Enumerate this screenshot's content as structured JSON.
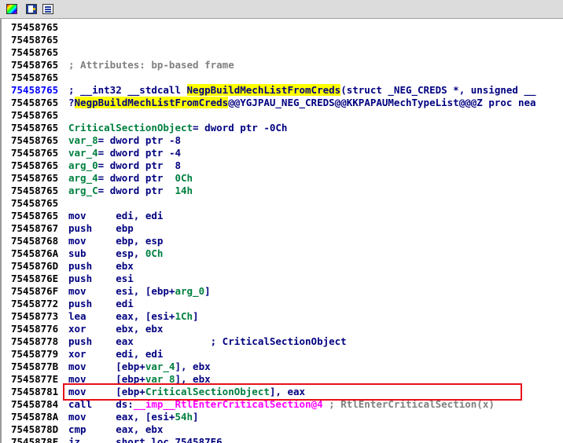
{
  "toolbar": {
    "icons": [
      "color-palette-icon",
      "edit-icon",
      "listing-icon"
    ]
  },
  "listing": [
    {
      "addr": "75458765",
      "parts": []
    },
    {
      "addr": "75458765",
      "parts": []
    },
    {
      "addr": "75458765",
      "parts": []
    },
    {
      "addr": "75458765",
      "parts": [
        {
          "t": "; Attributes: bp-based frame",
          "c": "cmt"
        }
      ]
    },
    {
      "addr": "75458765",
      "parts": []
    },
    {
      "addr": "75458765",
      "addr_style": "blue",
      "parts": [
        {
          "t": "; __int32 __stdcall ",
          "c": "dark"
        },
        {
          "t": "NegpBuildMechListFromCreds",
          "c": "dark hl"
        },
        {
          "t": "(struct _NEG_CREDS *, unsigned __",
          "c": "dark"
        }
      ]
    },
    {
      "addr": "75458765",
      "parts": [
        {
          "t": "?",
          "c": "dark"
        },
        {
          "t": "NegpBuildMechListFromCreds",
          "c": "dark hl"
        },
        {
          "t": "@@YGJPAU_NEG_CREDS@@KKPAPAUMechTypeList@@@Z proc nea",
          "c": "dark"
        }
      ]
    },
    {
      "addr": "75458765",
      "parts": []
    },
    {
      "addr": "75458765",
      "parts": [
        {
          "t": "CriticalSectionObject",
          "c": "grn"
        },
        {
          "t": "= dword ptr -0Ch",
          "c": "dark"
        }
      ]
    },
    {
      "addr": "75458765",
      "parts": [
        {
          "t": "var_8",
          "c": "grn"
        },
        {
          "t": "= dword ptr -8",
          "c": "dark"
        }
      ]
    },
    {
      "addr": "75458765",
      "parts": [
        {
          "t": "var_4",
          "c": "grn"
        },
        {
          "t": "= dword ptr -4",
          "c": "dark"
        }
      ]
    },
    {
      "addr": "75458765",
      "parts": [
        {
          "t": "arg_0",
          "c": "grn"
        },
        {
          "t": "= dword ptr  8",
          "c": "dark"
        }
      ]
    },
    {
      "addr": "75458765",
      "parts": [
        {
          "t": "arg_4",
          "c": "grn"
        },
        {
          "t": "= dword ptr  ",
          "c": "dark"
        },
        {
          "t": "0Ch",
          "c": "grn"
        }
      ]
    },
    {
      "addr": "75458765",
      "parts": [
        {
          "t": "arg_C",
          "c": "grn"
        },
        {
          "t": "= dword ptr  ",
          "c": "dark"
        },
        {
          "t": "14h",
          "c": "grn"
        }
      ]
    },
    {
      "addr": "75458765",
      "parts": []
    },
    {
      "addr": "75458765",
      "parts": [
        {
          "t": "mov     edi, edi",
          "c": "dark"
        }
      ]
    },
    {
      "addr": "75458767",
      "parts": [
        {
          "t": "push    ebp",
          "c": "dark"
        }
      ]
    },
    {
      "addr": "75458768",
      "parts": [
        {
          "t": "mov     ebp, esp",
          "c": "dark"
        }
      ]
    },
    {
      "addr": "7545876A",
      "parts": [
        {
          "t": "sub     esp, ",
          "c": "dark"
        },
        {
          "t": "0Ch",
          "c": "grn"
        }
      ]
    },
    {
      "addr": "7545876D",
      "parts": [
        {
          "t": "push    ebx",
          "c": "dark"
        }
      ]
    },
    {
      "addr": "7545876E",
      "parts": [
        {
          "t": "push    esi",
          "c": "dark"
        }
      ]
    },
    {
      "addr": "7545876F",
      "parts": [
        {
          "t": "mov     esi, [ebp+",
          "c": "dark"
        },
        {
          "t": "arg_0",
          "c": "grn"
        },
        {
          "t": "]",
          "c": "dark"
        }
      ]
    },
    {
      "addr": "75458772",
      "parts": [
        {
          "t": "push    edi",
          "c": "dark"
        }
      ]
    },
    {
      "addr": "75458773",
      "parts": [
        {
          "t": "lea     eax, [esi+",
          "c": "dark"
        },
        {
          "t": "1Ch",
          "c": "grn"
        },
        {
          "t": "]",
          "c": "dark"
        }
      ]
    },
    {
      "addr": "75458776",
      "parts": [
        {
          "t": "xor     ebx, ebx",
          "c": "dark"
        }
      ]
    },
    {
      "addr": "75458778",
      "parts": [
        {
          "t": "push    eax             ; CriticalSectionObject",
          "c": "dark"
        }
      ]
    },
    {
      "addr": "75458779",
      "parts": [
        {
          "t": "xor     edi, edi",
          "c": "dark"
        }
      ]
    },
    {
      "addr": "7545877B",
      "parts": [
        {
          "t": "mov     [ebp+",
          "c": "dark"
        },
        {
          "t": "var_4",
          "c": "grn"
        },
        {
          "t": "], ebx",
          "c": "dark"
        }
      ]
    },
    {
      "addr": "7545877E",
      "parts": [
        {
          "t": "mov     [ebp+",
          "c": "dark"
        },
        {
          "t": "var_8",
          "c": "grn"
        },
        {
          "t": "], ebx",
          "c": "dark"
        }
      ]
    },
    {
      "addr": "75458781",
      "parts": [
        {
          "t": "mov     [ebp+",
          "c": "dark"
        },
        {
          "t": "CriticalSectionObject",
          "c": "grn"
        },
        {
          "t": "], eax",
          "c": "dark"
        }
      ]
    },
    {
      "addr": "75458784",
      "parts": [
        {
          "t": "call    ds:",
          "c": "dark"
        },
        {
          "t": "__imp__RtlEnterCriticalSection@4",
          "c": "mag"
        },
        {
          "t": " ; RtlEnterCriticalSection(x)",
          "c": "cmt"
        }
      ]
    },
    {
      "addr": "7545878A",
      "parts": [
        {
          "t": "mov     eax, [esi+",
          "c": "dark"
        },
        {
          "t": "54h",
          "c": "grn"
        },
        {
          "t": "]",
          "c": "dark"
        }
      ]
    },
    {
      "addr": "7545878D",
      "parts": [
        {
          "t": "cmp     eax, ebx",
          "c": "dark"
        }
      ]
    },
    {
      "addr": "7545878F",
      "parts": [
        {
          "t": "jz      short loc_754587E6",
          "c": "dark"
        }
      ]
    }
  ],
  "highlight_box": {
    "color": "#e8101a",
    "line_index": 30
  }
}
